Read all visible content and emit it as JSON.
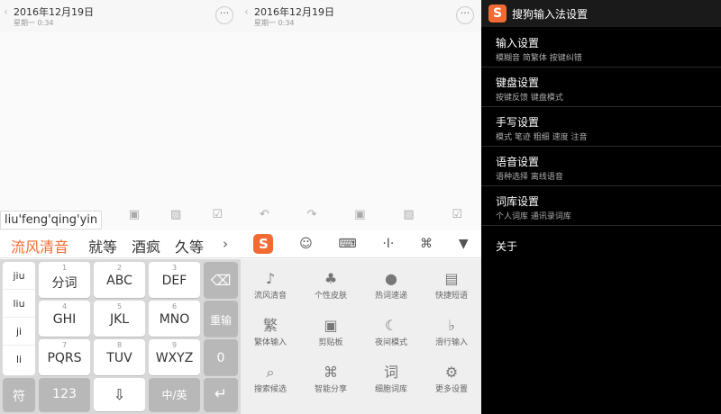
{
  "note": {
    "date": "2016年12月19日",
    "weekday": "星期一 0:34",
    "more": "···"
  },
  "input": {
    "pinyin": "liu'feng'qing'yin",
    "candidates": [
      "流风清音",
      "就等",
      "酒疯",
      "久等"
    ],
    "arrow": "›"
  },
  "keyboard": {
    "side": [
      "jiu",
      "liu",
      "ji",
      "li"
    ],
    "keys": [
      {
        "num": "1",
        "label": "分词"
      },
      {
        "num": "2",
        "label": "ABC"
      },
      {
        "num": "3",
        "label": "DEF"
      },
      {
        "num": "4",
        "label": "GHI"
      },
      {
        "num": "5",
        "label": "JKL"
      },
      {
        "num": "6",
        "label": "MNO"
      },
      {
        "num": "7",
        "label": "PQRS"
      },
      {
        "num": "8",
        "label": "TUV"
      },
      {
        "num": "9",
        "label": "WXYZ"
      }
    ],
    "delete": "⌫",
    "reinput": "重输",
    "zero": "0",
    "symbol": "符",
    "numbers": "123",
    "space": "⇩",
    "lang": "中/英",
    "enter": "↵"
  },
  "toolbar2": {
    "logo": "S",
    "items": [
      "☺",
      "⌨",
      "·I·",
      "⌘",
      "▼"
    ]
  },
  "panel": {
    "tiles": [
      {
        "icon": "♪",
        "label": "流风清音"
      },
      {
        "icon": "♣",
        "label": "个性皮肤"
      },
      {
        "icon": "●",
        "label": "热词速递"
      },
      {
        "icon": "▤",
        "label": "快捷短语"
      },
      {
        "icon": "繁",
        "label": "繁体输入"
      },
      {
        "icon": "▣",
        "label": "剪贴板"
      },
      {
        "icon": "☾",
        "label": "夜间模式"
      },
      {
        "icon": "♭",
        "label": "滑行输入"
      },
      {
        "icon": "⌕",
        "label": "搜索候选"
      },
      {
        "icon": "⌘",
        "label": "智能分享"
      },
      {
        "icon": "词",
        "label": "细胞词库"
      },
      {
        "icon": "⚙",
        "label": "更多设置"
      }
    ]
  },
  "settings": {
    "logo": "S",
    "title": "搜狗输入法设置",
    "items": [
      {
        "name": "输入设置",
        "sub": "模糊音 简繁体 按键纠错"
      },
      {
        "name": "键盘设置",
        "sub": "按键反馈 键盘模式"
      },
      {
        "name": "手写设置",
        "sub": "模式 笔迹 粗细 速度 注音"
      },
      {
        "name": "语音设置",
        "sub": "语种选择 离线语音"
      },
      {
        "name": "词库设置",
        "sub": "个人词库 通讯录词库"
      },
      {
        "name": "关于",
        "sub": ""
      }
    ]
  },
  "colors": {
    "accent": "#f26b32",
    "settings_bg": "#000000"
  }
}
